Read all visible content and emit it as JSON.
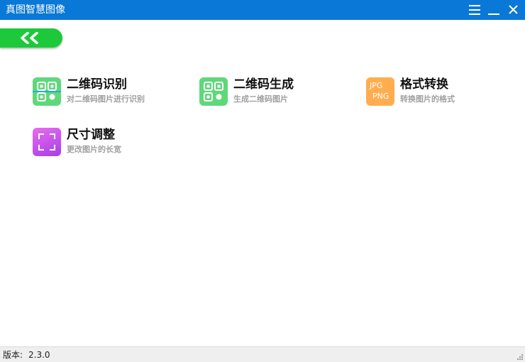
{
  "window": {
    "title": "真图智慧图像",
    "accent": "#0a78d7",
    "controls": [
      "menu-icon",
      "minimize-icon",
      "close-icon"
    ]
  },
  "back_button": {
    "icon": "double-chevron-left-icon",
    "color": "#1dc93b"
  },
  "tools": [
    {
      "title": "二维码识别",
      "subtitle": "对二维码图片进行识别",
      "icon": "qr-scan-icon",
      "color": "#5fd87a"
    },
    {
      "title": "二维码生成",
      "subtitle": "生成二维码图片",
      "icon": "qr-code-icon",
      "color": "#5fd87a"
    },
    {
      "title": "格式转换",
      "subtitle": "转换图片的格式",
      "icon": "format-convert-icon",
      "color": "#ffad4f",
      "icon_text": [
        "JPG",
        "PNG"
      ]
    },
    {
      "title": "尺寸调整",
      "subtitle": "更改图片的长宽",
      "icon": "resize-frame-icon",
      "color": "#c052ec"
    }
  ],
  "status": {
    "version_label": "版本:",
    "version": "2.3.0"
  }
}
